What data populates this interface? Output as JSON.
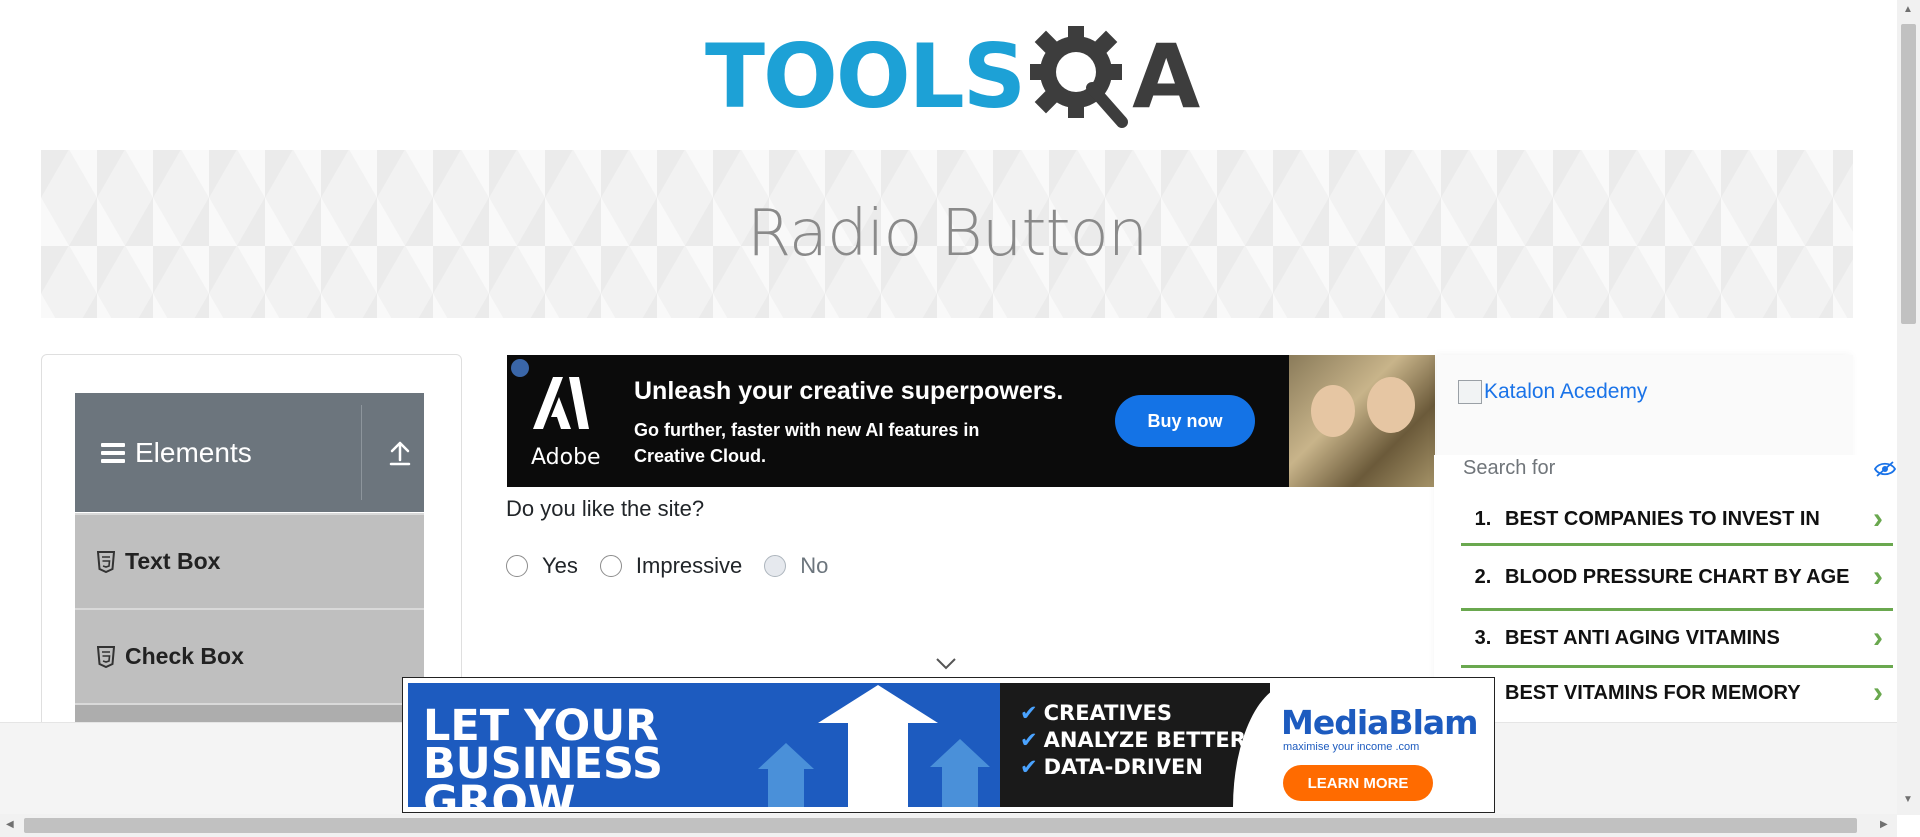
{
  "header": {
    "logo_tools": "TOOLS",
    "logo_qa": "A",
    "logo_colors": {
      "tools": "#1da1d6",
      "gear": "#3d3d3d"
    }
  },
  "banner": {
    "title": "Radio Button"
  },
  "sidebar": {
    "group_title": "Elements",
    "items": [
      {
        "label": "Text Box",
        "icon": "html5-icon"
      },
      {
        "label": "Check Box",
        "icon": "html5-icon"
      }
    ]
  },
  "top_ad": {
    "brand": "Adobe",
    "headline": "Unleash your creative superpowers.",
    "subtext": "Go further, faster with new AI features in Creative Cloud.",
    "button": "Buy now"
  },
  "form": {
    "question": "Do you like the site?",
    "options": [
      {
        "label": "Yes",
        "checked": false,
        "disabled": false
      },
      {
        "label": "Impressive",
        "checked": false,
        "disabled": false
      },
      {
        "label": "No",
        "checked": false,
        "disabled": true
      }
    ]
  },
  "side_ad": {
    "image_alt": "Katalon Acedemy",
    "search_label": "Search for",
    "results": [
      {
        "num": "1.",
        "text": "BEST COMPANIES TO INVEST IN"
      },
      {
        "num": "2.",
        "text": "BLOOD PRESSURE CHART BY AGE"
      },
      {
        "num": "3.",
        "text": "BEST ANTI AGING VITAMINS"
      },
      {
        "num": "",
        "text": "BEST VITAMINS FOR MEMORY"
      }
    ]
  },
  "bottom_ad": {
    "headline": "LET YOUR BUSINESS GROW",
    "bullets": [
      "CREATIVES",
      "ANALYZE BETTER",
      "DATA-DRIVEN"
    ],
    "brand": "MediaBlam",
    "tagline": "maximise your income .com",
    "button": "LEARN MORE"
  }
}
